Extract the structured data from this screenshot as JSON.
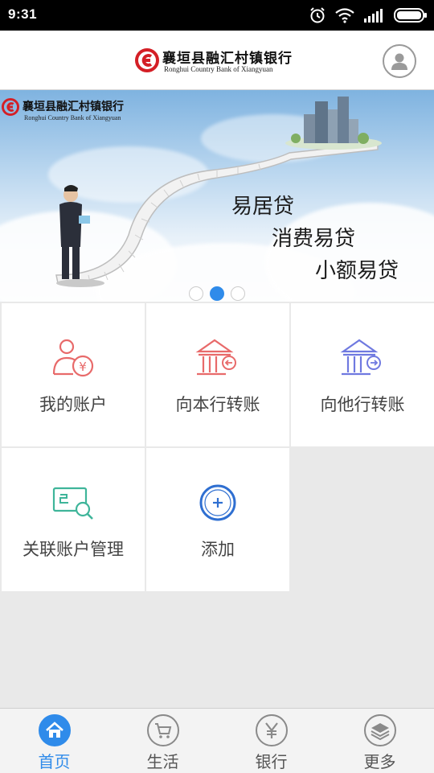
{
  "status_bar": {
    "time": "9:31"
  },
  "header": {
    "bank_name_cn": "襄垣县融汇村镇银行",
    "bank_name_en": "Ronghui Country Bank of Xiangyuan"
  },
  "banner": {
    "bank_name_cn": "襄垣县融汇村镇银行",
    "bank_name_en": "Ronghui Country Bank of Xiangyuan",
    "slogans": [
      "易居贷",
      "消费易贷",
      "小额易贷"
    ],
    "slide_count": 3,
    "active_slide": 2
  },
  "menu": [
    {
      "label": "我的账户",
      "icon": "account-icon"
    },
    {
      "label": "向本行转账",
      "icon": "bank-transfer-icon"
    },
    {
      "label": "向他行转账",
      "icon": "other-bank-transfer-icon"
    },
    {
      "label": "关联账户管理",
      "icon": "linked-account-icon"
    },
    {
      "label": "添加",
      "icon": "add-icon"
    }
  ],
  "tabs": [
    {
      "label": "首页",
      "icon": "home-icon",
      "active": true
    },
    {
      "label": "生活",
      "icon": "cart-icon",
      "active": false
    },
    {
      "label": "银行",
      "icon": "yen-icon",
      "active": false
    },
    {
      "label": "更多",
      "icon": "layers-icon",
      "active": false
    }
  ],
  "colors": {
    "accent": "#2f8bea",
    "account_icon": "#e86a6a",
    "own_bank_icon": "#e86a6a",
    "other_bank_icon": "#6f79e0",
    "linked_icon": "#3fb59a",
    "add_icon": "#2f6fd1"
  }
}
